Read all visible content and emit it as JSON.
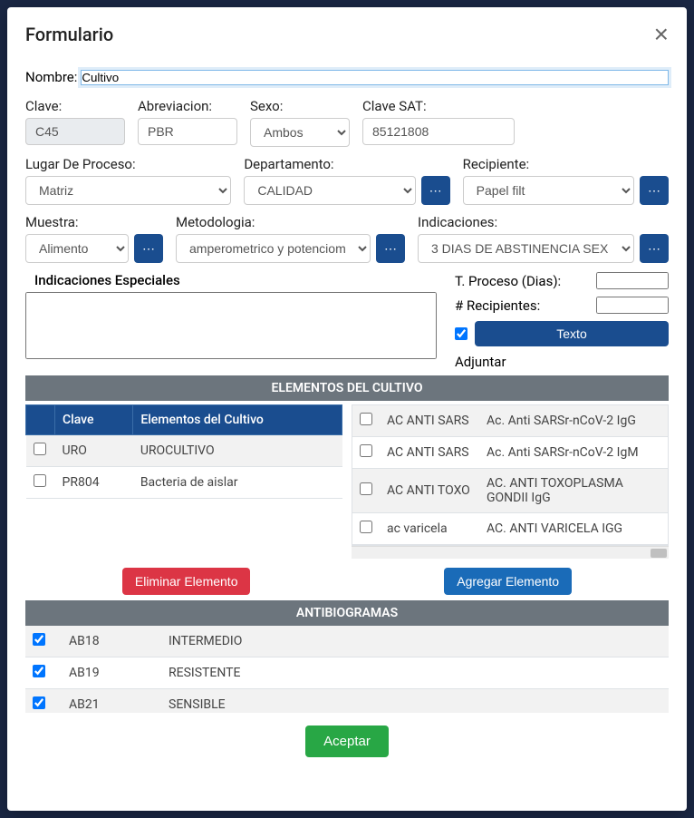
{
  "modal": {
    "title": "Formulario",
    "close": "×"
  },
  "fields": {
    "nombre_label": "Nombre:",
    "nombre_value": "Cultivo",
    "clave_label": "Clave:",
    "clave_value": "C45",
    "abrev_label": "Abreviacion:",
    "abrev_value": "PBR",
    "sexo_label": "Sexo:",
    "sexo_value": "Ambos",
    "clavesat_label": "Clave SAT:",
    "clavesat_value": "85121808",
    "lugar_label": "Lugar De Proceso:",
    "lugar_value": "Matriz",
    "depto_label": "Departamento:",
    "depto_value": "CALIDAD",
    "recip_label": "Recipiente:",
    "recip_value": "Papel filt",
    "muestra_label": "Muestra:",
    "muestra_value": "Alimento",
    "metod_label": "Metodologia:",
    "metod_value": "amperometrico y potenciom",
    "indic_label": "Indicaciones:",
    "indic_value": "3 DIAS DE ABSTINENCIA SEX",
    "indic_esp_label": "Indicaciones Especiales",
    "tproc_label": "T. Proceso (Dias):",
    "nrecip_label": "# Recipientes:",
    "adjuntar_label": "Adjuntar",
    "texto_btn": "Texto"
  },
  "sections": {
    "cultivo_header": "ELEMENTOS DEL CULTIVO",
    "ab_header": "ANTIBIOGRAMAS"
  },
  "cultivo_table": {
    "col_clave": "Clave",
    "col_elem": "Elementos del Cultivo",
    "rows": [
      {
        "clave": "URO",
        "elem": "UROCULTIVO"
      },
      {
        "clave": "PR804",
        "elem": "Bacteria de aislar"
      }
    ]
  },
  "cultivo_options": [
    {
      "c1": "AC ANTI SARS",
      "c2": "Ac. Anti SARSr-nCoV-2 IgG"
    },
    {
      "c1": "AC ANTI SARS",
      "c2": "Ac. Anti SARSr-nCoV-2 IgM"
    },
    {
      "c1": "AC ANTI TOXO",
      "c2": "AC. ANTI TOXOPLASMA GONDII IgG"
    },
    {
      "c1": "ac varicela",
      "c2": "AC. ANTI VARICELA IGG"
    }
  ],
  "ab_rows": [
    {
      "clave": "AB18",
      "elem": "INTERMEDIO"
    },
    {
      "clave": "AB19",
      "elem": "RESISTENTE"
    },
    {
      "clave": "AB21",
      "elem": "SENSIBLE"
    }
  ],
  "buttons": {
    "eliminar": "Eliminar Elemento",
    "agregar": "Agregar Elemento",
    "aceptar": "Aceptar"
  },
  "colors": {
    "primary": "#1a4d8f",
    "danger": "#dc3545",
    "success": "#28a745",
    "header_gray": "#6c757d"
  }
}
